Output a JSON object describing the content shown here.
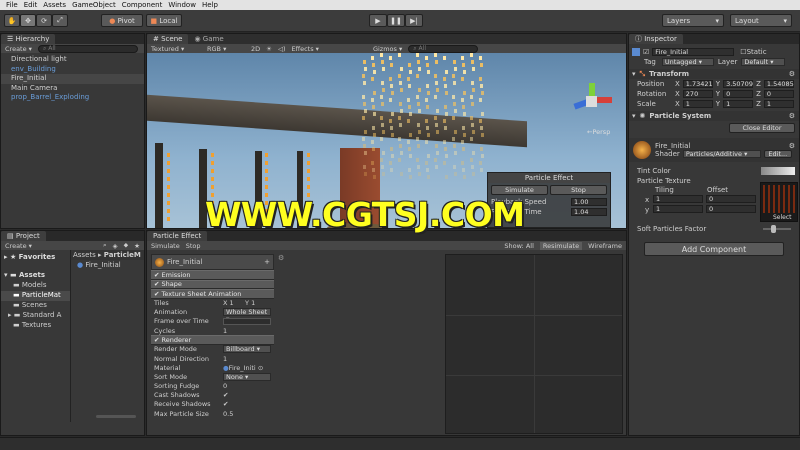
{
  "menu": [
    "File",
    "Edit",
    "Assets",
    "GameObject",
    "Component",
    "Window",
    "Help"
  ],
  "toolbar": {
    "pivot": "Pivot",
    "local": "Local",
    "layers": "Layers",
    "layout": "Layout"
  },
  "hierarchy": {
    "tab": "Hierarchy",
    "create": "Create",
    "search": "All",
    "items": [
      {
        "label": "Directional light",
        "color": "normal"
      },
      {
        "label": "env_Building",
        "color": "blue"
      },
      {
        "label": "Fire_Initial",
        "color": "selected"
      },
      {
        "label": "Main Camera",
        "color": "normal"
      },
      {
        "label": "prop_Barrel_Exploding",
        "color": "blue"
      }
    ]
  },
  "scene": {
    "tab_scene": "Scene",
    "tab_game": "Game",
    "shading": "Textured",
    "render": "RGB",
    "mode2d": "2D",
    "effects": "Effects",
    "gizmos": "Gizmos",
    "search": "All",
    "persp": "←Persp",
    "overlay": {
      "title": "Particle Effect",
      "simulate": "Simulate",
      "stop": "Stop",
      "speed_label": "Playback Speed",
      "speed": "1.00",
      "time_label": "Playback Time",
      "time": "1.04"
    }
  },
  "watermark": "WWW.CGTSJ.COM",
  "project": {
    "tab": "Project",
    "create": "Create",
    "favorites": "Favorites",
    "assets": "Assets",
    "folders": [
      "Models",
      "ParticleMat",
      "Scenes",
      "Standard A",
      "Textures"
    ],
    "breadcrumb_root": "Assets",
    "breadcrumb_child": "ParticleM",
    "files": [
      "Fire_Initial"
    ]
  },
  "particle_effect": {
    "tab": "Particle Effect",
    "simulate": "Simulate",
    "stop": "Stop",
    "show": "Show: All",
    "resimulate": "Resimulate",
    "wireframe": "Wireframe",
    "system_name": "Fire_Initial",
    "modules": {
      "emission": "Emission",
      "shape": "Shape",
      "tsa": "Texture Sheet Animation",
      "renderer": "Renderer"
    },
    "tiles_label": "Tiles",
    "tiles_x_label": "X",
    "tiles_x": "1",
    "tiles_y_label": "Y",
    "tiles_y": "1",
    "animation_label": "Animation",
    "animation": "Whole Sheet",
    "frame_label": "Frame over Time",
    "cycles_label": "Cycles",
    "cycles": "1",
    "render_mode_label": "Render Mode",
    "render_mode": "Billboard",
    "normal_dir_label": "Normal Direction",
    "normal_dir": "1",
    "material_label": "Material",
    "material": "Fire_Initi",
    "sort_mode_label": "Sort Mode",
    "sort_mode": "None",
    "sorting_fudge_label": "Sorting Fudge",
    "sorting_fudge": "0",
    "cast_shadows_label": "Cast Shadows",
    "receive_shadows_label": "Receive Shadows",
    "max_size_label": "Max Particle Size",
    "max_size": "0.5"
  },
  "inspector": {
    "tab": "Inspector",
    "name": "Fire_Initial",
    "static": "Static",
    "tag_label": "Tag",
    "tag": "Untagged",
    "layer_label": "Layer",
    "layer": "Default",
    "transform": "Transform",
    "position_label": "Position",
    "pos_x": "1.73421",
    "pos_y": "3.50709",
    "pos_z": "1.54085",
    "rotation_label": "Rotation",
    "rot_x": "270",
    "rot_y": "0",
    "rot_z": "0",
    "scale_label": "Scale",
    "scale_x": "1",
    "scale_y": "1",
    "scale_z": "1",
    "axis_x": "X",
    "axis_y": "Y",
    "axis_z": "Z",
    "particle_system": "Particle System",
    "close_editor": "Close Editor",
    "material_name": "Fire_Initial",
    "shader_label": "Shader",
    "shader": "Particles/Additive",
    "edit": "Edit...",
    "tint_label": "Tint Color",
    "texture_label": "Particle Texture",
    "tiling_label": "Tiling",
    "offset_label": "Offset",
    "x_label": "x",
    "tiling_x": "1",
    "offset_x": "0",
    "y_label": "y",
    "tiling_y": "1",
    "offset_y": "0",
    "select": "Select",
    "soft_label": "Soft Particles Factor",
    "add_component": "Add Component"
  }
}
